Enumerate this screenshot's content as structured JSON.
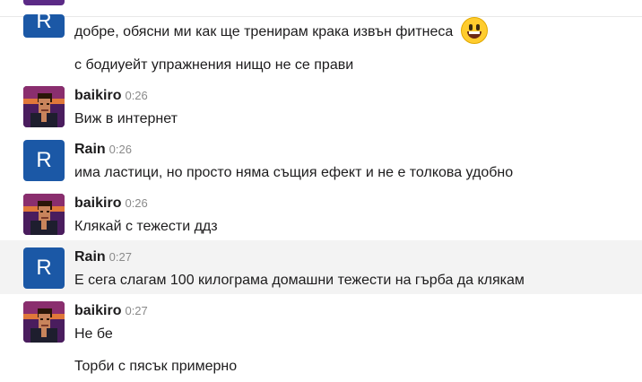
{
  "messages": [
    {
      "text": "добре, обясни ми как ще тренирам крака извън фитнеса",
      "emoji": "grinning-face-emoji"
    },
    {
      "text": "с бодиуейт упражнения нищо не се прави"
    },
    {
      "author": "baikiro",
      "time": "0:26",
      "text": "Виж в интернет"
    },
    {
      "author": "Rain",
      "avatar_letter": "R",
      "time": "0:26",
      "text": "има ластици, но просто няма същия ефект и не е толкова удобно"
    },
    {
      "author": "baikiro",
      "time": "0:26",
      "text": "Клякай с тежести ддз"
    },
    {
      "author": "Rain",
      "avatar_letter": "R",
      "time": "0:27",
      "text": "Е сега слагам 100 килограма домашни тежести на гърба да клякам"
    },
    {
      "author": "baikiro",
      "time": "0:27",
      "text": "Не бе"
    },
    {
      "text": "Торби с пясък примерно"
    }
  ],
  "top_avatar_letter": "R",
  "colors": {
    "rain_avatar": "#1b58a6",
    "highlight_row": "#f3f3f3",
    "top_partial_avatar": "#5b2a86"
  }
}
